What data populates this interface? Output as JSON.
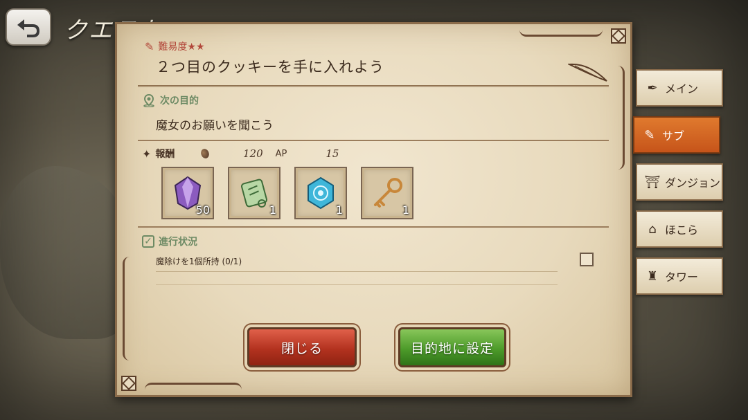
{
  "header": {
    "back_label": "",
    "title": "クエストボード"
  },
  "quest": {
    "difficulty": "難易度★★",
    "title": "２つ目のクッキーを手に入れよう",
    "objective_label": "次の目的",
    "objective_text": "魔女のお願いを聞こう",
    "reward_label": "報酬",
    "reward_gold": "120",
    "reward_ap_label": "AP",
    "reward_ap": "15",
    "items": [
      {
        "icon": "purple-gem-icon",
        "count": "50"
      },
      {
        "icon": "scroll-icon",
        "count": "1"
      },
      {
        "icon": "blue-crystal-icon",
        "count": "1"
      },
      {
        "icon": "key-icon",
        "count": "1"
      }
    ],
    "progress_label": "進行状況",
    "progress_text": "魔除けを1個所持 (0/1)"
  },
  "buttons": {
    "close": "閉じる",
    "set_destination": "目的地に設定"
  },
  "tabs": [
    {
      "label": "メイン",
      "icon": "quill-icon",
      "active": false
    },
    {
      "label": "サブ",
      "icon": "pen-icon",
      "active": true
    },
    {
      "label": "ダンジョン",
      "icon": "gate-icon",
      "active": false
    },
    {
      "label": "ほこら",
      "icon": "shrine-icon",
      "active": false
    },
    {
      "label": "タワー",
      "icon": "tower-icon",
      "active": false
    }
  ],
  "colors": {
    "accent_active_tab": "#d2621f",
    "close_button": "#c03a24",
    "set_button": "#4d9b2a",
    "section_label": "#6d8a64"
  }
}
